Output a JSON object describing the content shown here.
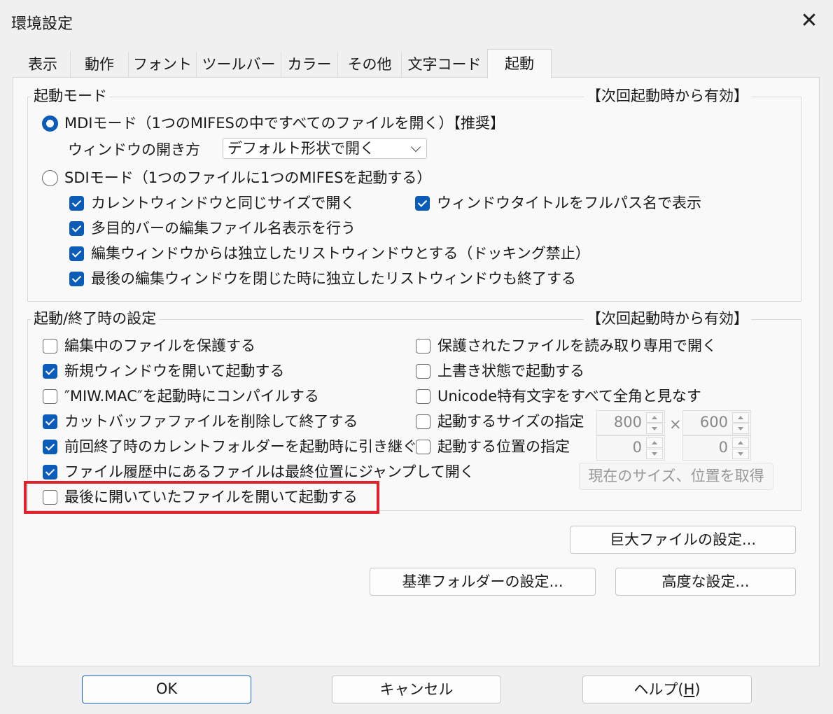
{
  "window": {
    "title": "環境設定"
  },
  "tabs": [
    "表示",
    "動作",
    "フォント",
    "ツールバー",
    "カラー",
    "その他",
    "文字コード",
    "起動"
  ],
  "startup_mode": {
    "title": "起動モード",
    "note": "【次回起動時から有効】",
    "mdi_label": "MDIモード（1つのMIFESの中ですべてのファイルを開く）【推奨】",
    "window_open_label": "ウィンドウの開き方",
    "window_open_value": "デフォルト形状で開く",
    "sdi_label": "SDIモード（1つのファイルに1つのMIFESを起動する）",
    "sdi_options": {
      "same_size": "カレントウィンドウと同じサイズで開く",
      "fullpath_title": "ウィンドウタイトルをフルパス名で表示",
      "multibar": "多目的バーの編集ファイル名表示を行う",
      "list_window": "編集ウィンドウからは独立したリストウィンドウとする（ドッキング禁止）",
      "close_list": "最後の編集ウィンドウを閉じた時に独立したリストウィンドウも終了する"
    }
  },
  "startup_exit": {
    "title": "起動/終了時の設定",
    "note": "【次回起動時から有効】",
    "protect_editing": "編集中のファイルを保護する",
    "new_window": "新規ウィンドウを開いて起動する",
    "compile_mac": "″MIW.MAC″を起動時にコンパイルする",
    "delete_cut_buffer": "カットバッファファイルを削除して終了する",
    "inherit_folder": "前回終了時のカレントフォルダーを起動時に引き継ぐ",
    "jump_last_pos": "ファイル履歴中にあるファイルは最終位置にジャンプして開く",
    "reopen_last": "最後に開いていたファイルを開いて起動する",
    "readonly_protected": "保護されたファイルを読み取り専用で開く",
    "overwrite_mode": "上書き状態で起動する",
    "unicode_fullwidth": "Unicode特有文字をすべて全角と見なす",
    "size_spec": "起動するサイズの指定",
    "pos_spec": "起動する位置の指定",
    "width": "800",
    "times": "×",
    "height": "600",
    "pos_x": "0",
    "pos_y": "0",
    "get_current": "現在のサイズ、位置を取得"
  },
  "buttons": {
    "huge_file": "巨大ファイルの設定...",
    "base_folder": "基準フォルダーの設定...",
    "advanced": "高度な設定...",
    "ok": "OK",
    "cancel": "キャンセル",
    "help": "ヘルプ(",
    "help_key": "H",
    "help_end": ")"
  },
  "colors": {
    "accent": "#0a5cb8",
    "highlight": "#e0202a"
  }
}
